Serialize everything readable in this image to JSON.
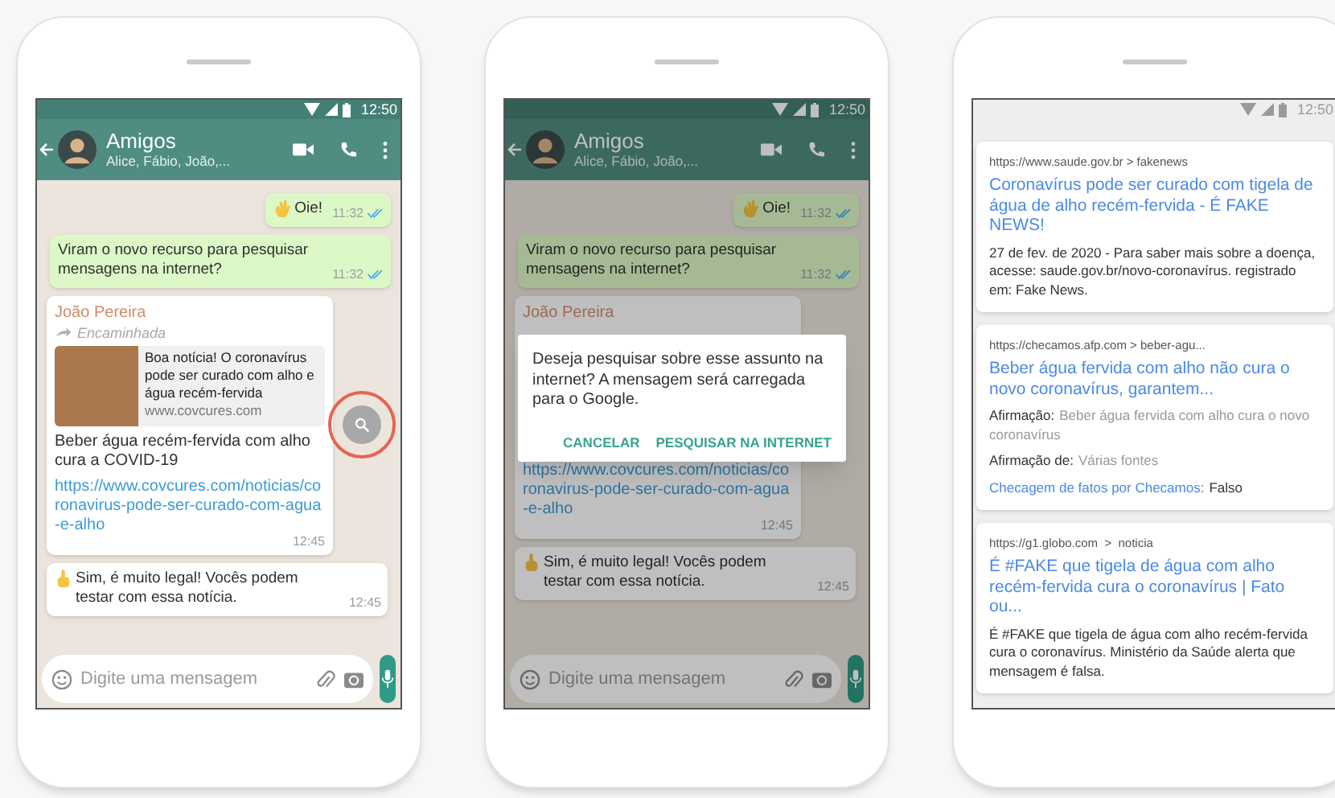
{
  "phones": [
    {
      "kind": "chat",
      "status_time": "12:50",
      "chat": {
        "title": "Amigos",
        "subtitle": "Alice, Fábio, João,..."
      },
      "messages": [
        {
          "kind": "outgoing",
          "text": "Oie!",
          "time": "11:32",
          "read": true
        },
        {
          "kind": "outgoing",
          "text": "Viram o novo recurso para pesquisar mensagens na internet?",
          "time": "11:32",
          "read": true
        },
        {
          "kind": "forwarded",
          "sender": "João Pereira",
          "forwarded_label": "Encaminhada",
          "preview": {
            "title": "Boa notícia! O coronavírus pode ser curado com alho e água recém-fervida",
            "domain": "www.covcures.com"
          },
          "text": "Beber água recém-fervida com alho cura a COVID-19",
          "link": "https://www.covcures.com/noticias/coronavirus-pode-ser-curado-com-agua-e-alho",
          "time": "12:45",
          "search_button": {
            "highlighted": true
          }
        },
        {
          "kind": "incoming",
          "text": "Sim, é muito legal! Vocês podem testar com essa notícia.",
          "time": "12:45"
        }
      ],
      "composer": {
        "placeholder": "Digite uma mensagem"
      }
    },
    {
      "kind": "chat",
      "status_time": "12:50",
      "chat": {
        "title": "Amigos",
        "subtitle": "Alice, Fábio, João,..."
      },
      "messages": [
        {
          "kind": "outgoing",
          "text": "Oie!",
          "time": "11:32",
          "read": true
        },
        {
          "kind": "outgoing",
          "text": "Viram o novo recurso para pesquisar mensagens na internet?",
          "time": "11:32",
          "read": true
        },
        {
          "kind": "forwarded",
          "sender": "João Pereira",
          "link": "https://www.covcures.com/noticias/coronavirus-pode-ser-curado-com-agua-e-alho",
          "time": "12:45"
        },
        {
          "kind": "incoming",
          "text": "Sim, é muito legal! Vocês podem testar com essa notícia.",
          "time": "12:45"
        }
      ],
      "composer": {
        "placeholder": "Digite uma mensagem"
      },
      "dialog": {
        "text": "Deseja pesquisar sobre esse assunto na internet? A mensagem será carregada para o Google.",
        "buttons": [
          "CANCELAR",
          "PESQUISAR NA INTERNET"
        ]
      }
    },
    {
      "kind": "results",
      "status_time": "12:50",
      "results": [
        {
          "url": "https://www.saude.gov.br > fakenews",
          "title": "Coronavírus pode ser curado com tigela de água de alho recém-fervida - É FAKE NEWS!",
          "snippet": "27 de fev. de 2020 - Para saber mais sobre a doença, acesse: saude.gov.br/novo-coronavírus. registrado em: Fake News."
        },
        {
          "url": "https://checamos.afp.com > beber-agu...",
          "title": "Beber água fervida com alho não cura o novo coronavírus, garantem...",
          "facts": [
            {
              "label": "Afirmação:",
              "value": "Beber água fervida com alho cura o novo coronavírus"
            },
            {
              "label": "Afirmação de:",
              "value": "Várias fontes"
            }
          ],
          "fact_check": {
            "label": "Checagem de fatos por Checamos:",
            "value": "Falso"
          }
        },
        {
          "url": "https://g1.globo.com  >  noticia",
          "title": "É #FAKE que tigela de água com alho recém-fervida cura o coronavírus | Fato ou...",
          "snippet": "É #FAKE que tigela de água com alho recém-fervida cura o coronavírus. Ministério da Saúde alerta que mensagem é falsa."
        }
      ]
    }
  ]
}
